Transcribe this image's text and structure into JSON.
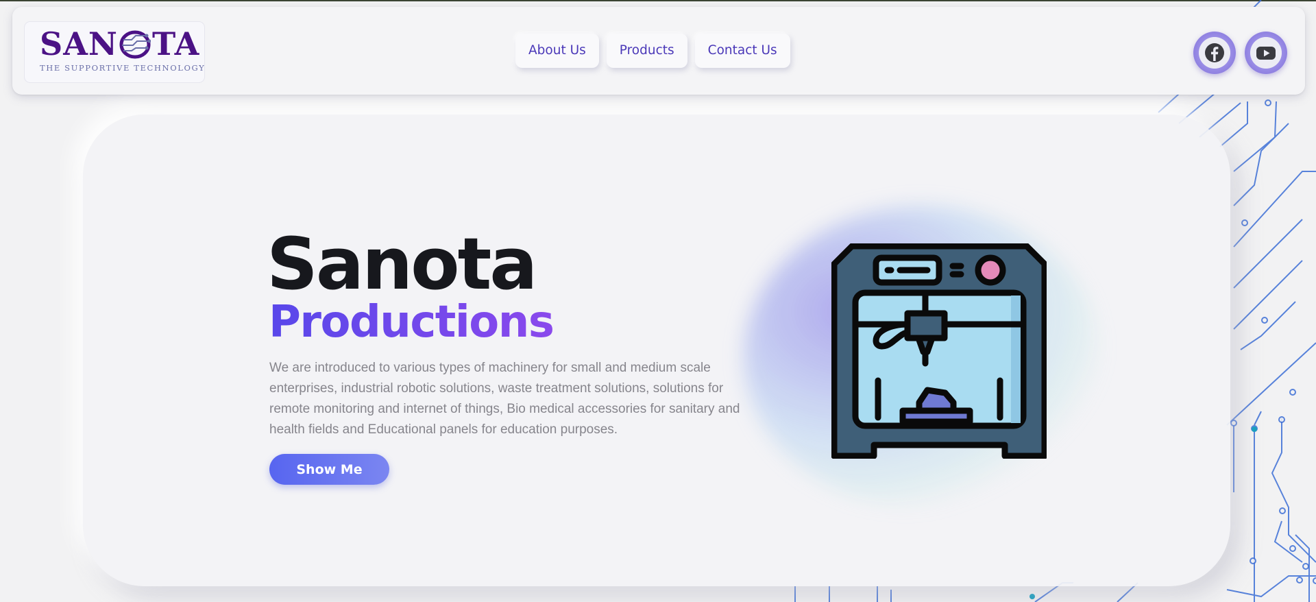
{
  "brand": {
    "name_left": "SAN",
    "name_right": "TA",
    "tagline": "THE SUPPORTIVE TECHNOLOGY",
    "color": "#4b1285"
  },
  "nav": {
    "items": [
      {
        "label": "About Us"
      },
      {
        "label": "Products"
      },
      {
        "label": "Contact Us"
      }
    ]
  },
  "social": {
    "items": [
      {
        "icon": "facebook-icon"
      },
      {
        "icon": "youtube-icon"
      }
    ],
    "accent": "#7d6cd8"
  },
  "hero": {
    "title": "Sanota",
    "subtitle": "Productions",
    "description": "We are introduced to various types of machinery for small and medium scale enterprises, industrial robotic solutions, waste treatment solutions, solutions for remote monitoring and internet of things, Bio medical accessories for sanitary and health fields and Educational panels for education purposes.",
    "button_label": "Show Me",
    "illustration_icon": "3d-printer-icon",
    "accent_gradient": [
      "#5847ea",
      "#8a49ec"
    ]
  }
}
